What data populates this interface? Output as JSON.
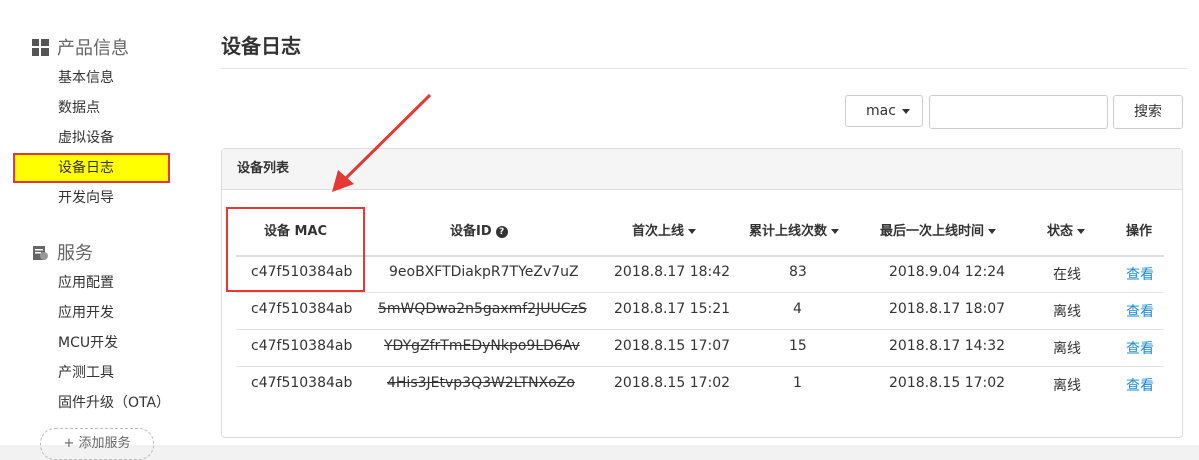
{
  "sidebar": {
    "product_title": "产品信息",
    "product_items": [
      "基本信息",
      "数据点",
      "虚拟设备",
      "设备日志",
      "开发向导"
    ],
    "service_title": "服务",
    "service_items": [
      "应用配置",
      "应用开发",
      "MCU开发",
      "产测工具",
      "固件升级（OTA）"
    ],
    "add_service": "+ 添加服务"
  },
  "page": {
    "title": "设备日志",
    "filter_select": "mac",
    "search_placeholder": "",
    "search_button": "搜索"
  },
  "panel": {
    "title": "设备列表",
    "columns": [
      "设备 MAC",
      "设备ID",
      "首次上线",
      "累计上线次数",
      "最后一次上线时间",
      "状态",
      "操作"
    ],
    "rows": [
      {
        "mac": "c47f510384ab",
        "device_id": "9eoBXFTDiakpR7TYeZv7uZ",
        "first_online": "2018.8.17 18:42",
        "count": "83",
        "last_online": "2018.9.04 12:24",
        "status": "在线",
        "action": "查看"
      },
      {
        "mac": "c47f510384ab",
        "device_id": "5mWQDwa2n5gaxmf2JUUCzS",
        "first_online": "2018.8.17 15:21",
        "count": "4",
        "last_online": "2018.8.17 18:07",
        "status": "离线",
        "action": "查看"
      },
      {
        "mac": "c47f510384ab",
        "device_id": "YDYgZfrTmEDyNkpo9LD6Av",
        "first_online": "2018.8.15 17:07",
        "count": "15",
        "last_online": "2018.8.17 14:32",
        "status": "离线",
        "action": "查看"
      },
      {
        "mac": "c47f510384ab",
        "device_id": "4His3JEtvp3Q3W2LTNXoZo",
        "first_online": "2018.8.15 17:02",
        "count": "1",
        "last_online": "2018.8.15 17:02",
        "status": "离线",
        "action": "查看"
      }
    ]
  },
  "colors": {
    "highlight": "#ffff00",
    "annotation": "#e53935",
    "link": "#1a8bd6"
  }
}
